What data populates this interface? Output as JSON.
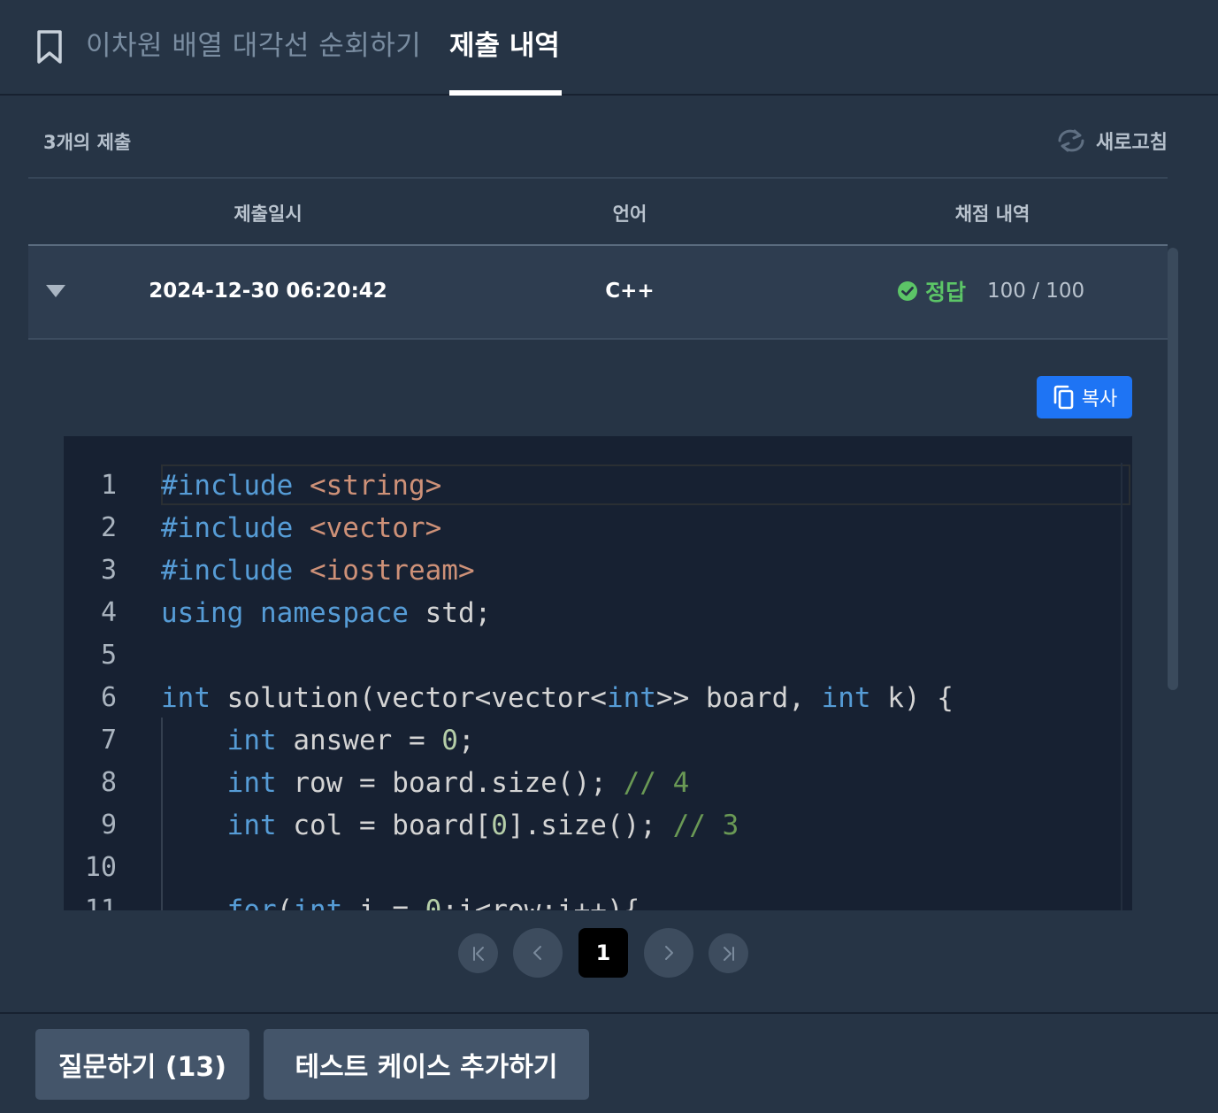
{
  "tabs": {
    "problem_title": "이차원 배열 대각선 순회하기",
    "history_label": "제출 내역"
  },
  "submissions": {
    "count_label": "3개의 제출",
    "refresh_label": "새로고침",
    "columns": [
      "제출일시",
      "언어",
      "채점 내역"
    ],
    "row": {
      "date": "2024-12-30 06:20:42",
      "language": "C++",
      "result": "정답",
      "score": "100 / 100"
    },
    "copy_label": "복사"
  },
  "code": {
    "line_numbers": [
      "1",
      "2",
      "3",
      "4",
      "5",
      "6",
      "7",
      "8",
      "9",
      "10",
      "11"
    ]
  },
  "pagination": {
    "current_page": "1"
  },
  "footer": {
    "ask_label": "질문하기 (13)",
    "add_testcase_label": "테스트 케이스 추가하기"
  },
  "colors": {
    "background": "#263445",
    "accent": "#1e74f4",
    "success": "#5cc567",
    "editor_bg": "#172132"
  },
  "icons": [
    "bookmark-icon",
    "refresh-icon",
    "caret-down-icon",
    "check-circle-icon",
    "copy-icon",
    "first-page-icon",
    "prev-page-icon",
    "next-page-icon",
    "last-page-icon"
  ]
}
